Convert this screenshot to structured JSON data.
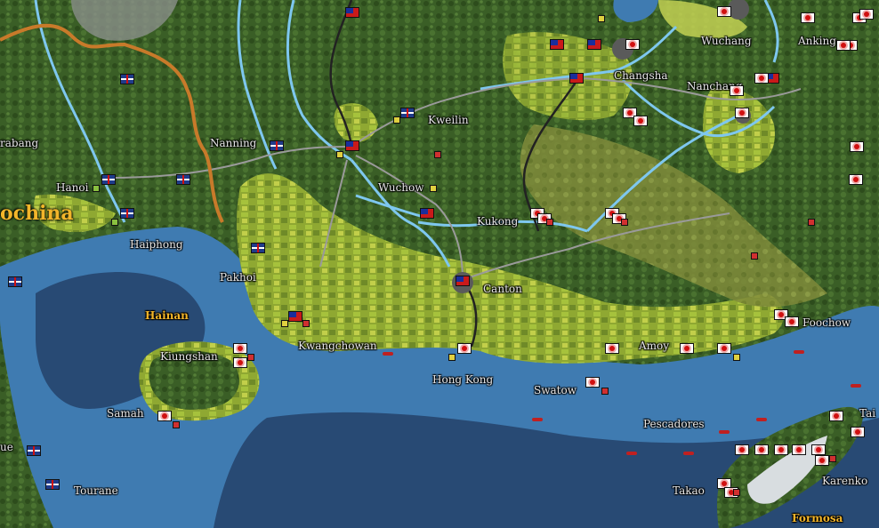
{
  "map": {
    "title": "",
    "colors": {
      "sea": "#3f7bb1",
      "deep_sea": "#24426a",
      "forest": "#3b5f26",
      "farmland": "#8fa832",
      "river": "#7ec7ef",
      "road": "#9a9a9a",
      "border": "#c87a2a"
    },
    "places": [
      {
        "name": "Wuchang"
      },
      {
        "name": "Anking"
      },
      {
        "name": "Changsha"
      },
      {
        "name": "Nanchang"
      },
      {
        "name": "Kweilin"
      },
      {
        "name": "Nanning"
      },
      {
        "name": "Hanoi"
      },
      {
        "name": "Wuchow"
      },
      {
        "name": "Kukong"
      },
      {
        "name": "Haiphong"
      },
      {
        "name": "Pakhoi"
      },
      {
        "name": "Canton"
      },
      {
        "name": "Foochow"
      },
      {
        "name": "Kwangchowan"
      },
      {
        "name": "Amoy"
      },
      {
        "name": "Kiungshan"
      },
      {
        "name": "Hong Kong"
      },
      {
        "name": "Swatow"
      },
      {
        "name": "Samah"
      },
      {
        "name": "Pescadores"
      },
      {
        "name": "Tourane"
      },
      {
        "name": "Takao"
      },
      {
        "name": "Karenko"
      },
      {
        "name": "rabang"
      },
      {
        "name": "ue"
      },
      {
        "name": "Tai"
      }
    ],
    "regions": [
      {
        "name": "Hainan"
      },
      {
        "name": "Formosa"
      },
      {
        "name": "ochina"
      }
    ],
    "units": {
      "japanese_count": 38,
      "chinese_count": 9,
      "british_count": 10
    }
  }
}
